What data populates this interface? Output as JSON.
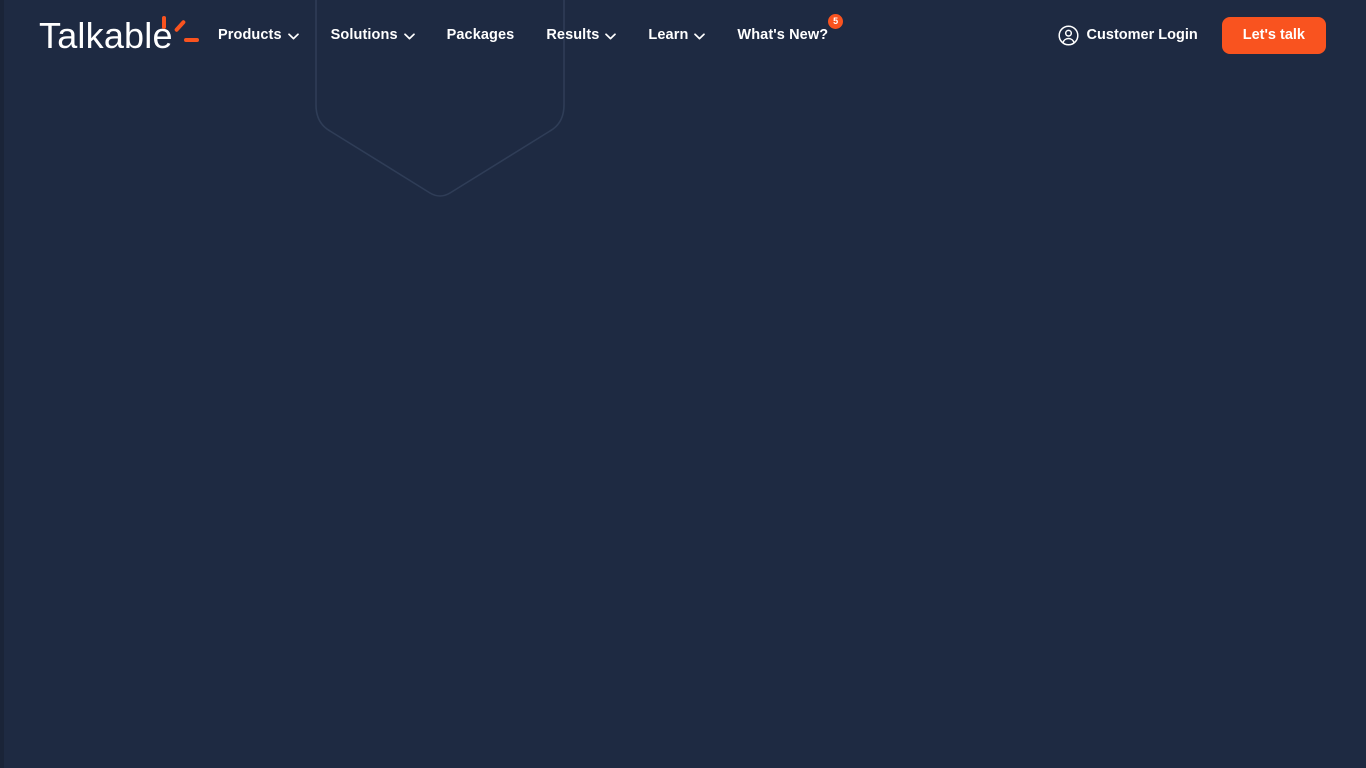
{
  "page": {
    "background_color": "#1e2a42",
    "accent_color": "#f9531f",
    "text_color": "#ffffff"
  },
  "header": {
    "logo": {
      "text": "Talkable",
      "icon": "sunburst-rays-icon",
      "ray_color": "#f9531f"
    },
    "nav_items": [
      {
        "label": "Products",
        "has_caret": true,
        "caret_icon": "chevron-down-icon",
        "badge": null
      },
      {
        "label": "Solutions",
        "has_caret": true,
        "caret_icon": "chevron-down-icon",
        "badge": null
      },
      {
        "label": "Packages",
        "has_caret": false,
        "caret_icon": "",
        "badge": null
      },
      {
        "label": "Results",
        "has_caret": true,
        "caret_icon": "chevron-down-icon",
        "badge": null
      },
      {
        "label": "Learn",
        "has_caret": true,
        "caret_icon": "chevron-down-icon",
        "badge": null
      },
      {
        "label": "What's New?",
        "has_caret": false,
        "caret_icon": "",
        "badge": "5"
      }
    ],
    "login": {
      "label": "Customer Login",
      "icon": "user-circle-icon"
    },
    "cta": {
      "label": "Let's talk",
      "background_color": "#f9531f"
    }
  },
  "main": {
    "decorative_shape": "shield-outline-shape",
    "content": ""
  }
}
